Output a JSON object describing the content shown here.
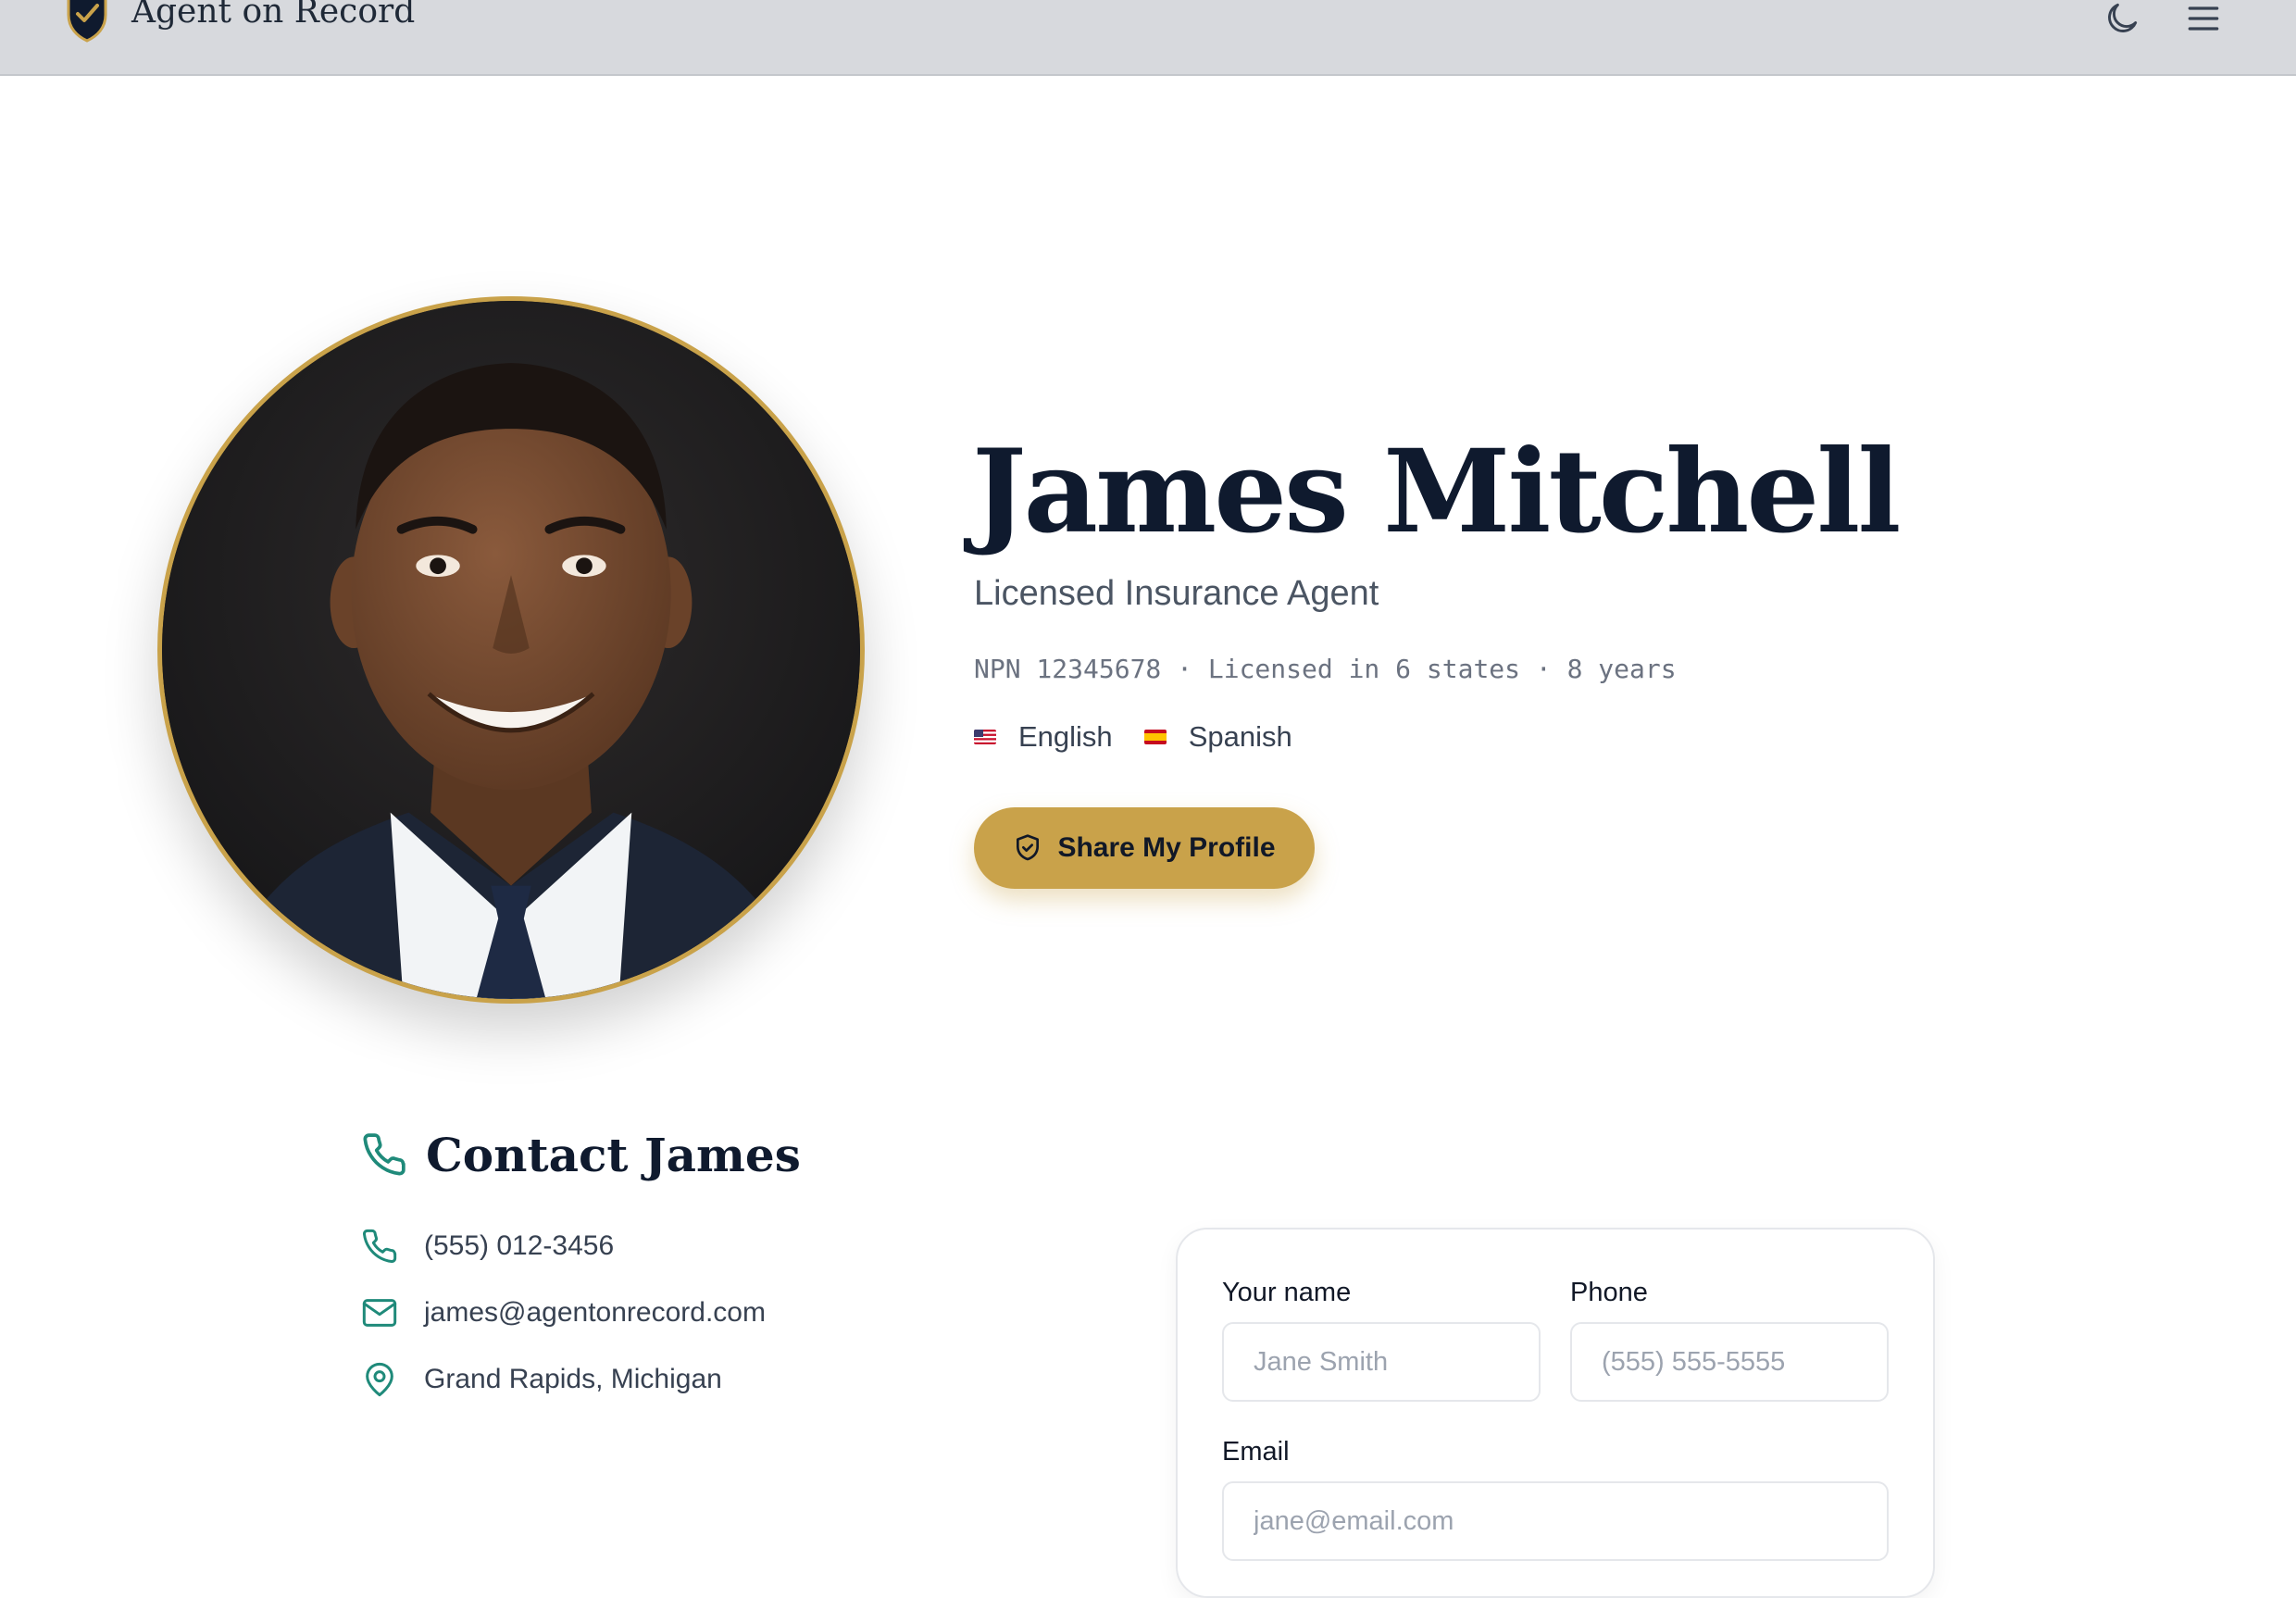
{
  "header": {
    "brand": "Agent on Record",
    "logo_icon": "shield-check-icon",
    "theme_toggle_icon": "moon-icon",
    "menu_icon": "hamburger-menu-icon"
  },
  "profile": {
    "name": "James Mitchell",
    "title": "Licensed Insurance Agent",
    "meta": "NPN 12345678 · Licensed in 6 states · 8 years",
    "languages": [
      {
        "label": "English",
        "flag": "us-flag-icon"
      },
      {
        "label": "Spanish",
        "flag": "es-flag-icon"
      }
    ],
    "share_button": {
      "label": "Share My Profile",
      "icon": "shield-check-icon"
    }
  },
  "contact": {
    "title": "Contact James",
    "phone": "(555) 012-3456",
    "email": "james@agentonrecord.com",
    "location": "Grand Rapids, Michigan"
  },
  "form": {
    "name_label": "Your name",
    "name_placeholder": "Jane Smith",
    "phone_label": "Phone",
    "phone_placeholder": "(555) 555-5555",
    "email_label": "Email",
    "email_placeholder": "jane@email.com"
  },
  "colors": {
    "accent_gold": "#c9a24a",
    "accent_teal": "#1f8a7a",
    "navy": "#0f1a2e"
  }
}
